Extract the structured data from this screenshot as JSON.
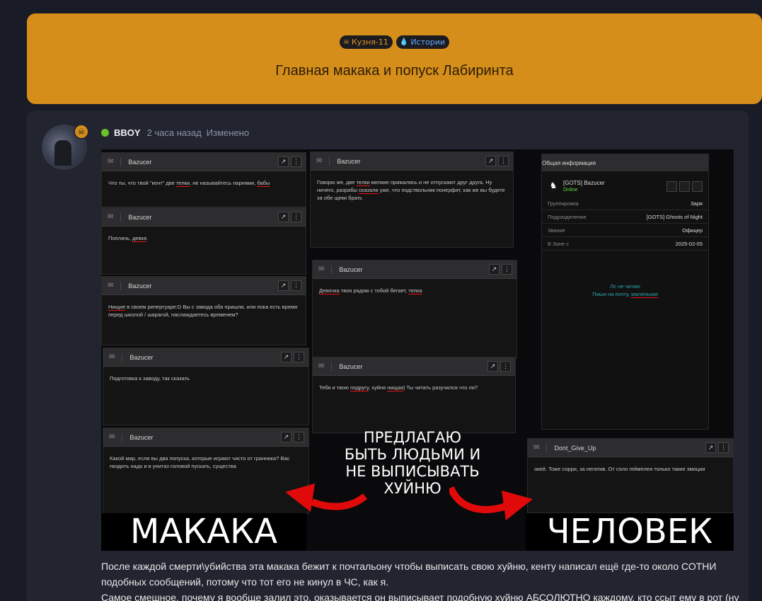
{
  "header": {
    "tags": [
      {
        "icon": "☠",
        "label": "Кузня-11"
      },
      {
        "icon": "💧",
        "label": "Истории"
      }
    ],
    "title": "Главная макака и попуск Лабиринта"
  },
  "post": {
    "username": "BBOY",
    "time": "2 часа назад",
    "edited": "Изменено",
    "paragraphs": [
      "После каждой смерти\\убийства эта макака бежит к почтальону чтобы выписать свою хуйню, кенту написал ещё где-то около СОТНИ подобных сообщений, потому что тот его не кинул в ЧС, как я.",
      "Самое смешное, почему я вообще залил это, оказывается он выписывает подобную хуйню АБСОЛЮТНО каждому, кто ссыт ему в рот (ну"
    ]
  },
  "screenshot": {
    "messages": [
      {
        "sender": "Bazucer",
        "pre": "Что ты, что твой \"кент\" две ",
        "u1": "телки",
        "mid": ", не называйтесь парнями, ",
        "u2": "бабы",
        "post": ""
      },
      {
        "sender": "Bazucer",
        "pre": "Поплачь, ",
        "u1": "девка",
        "mid": "",
        "u2": "",
        "post": ""
      },
      {
        "sender": "Bazucer",
        "pre": "",
        "u1": "Нищие",
        "mid": " в своем репертуаре:D Вы с завода оба пришли, или пока есть время перед школой / шарагой, наслаждаетесь временем?",
        "u2": "",
        "post": ""
      },
      {
        "sender": "Bazucer",
        "pre": "Подготовка к заводу, так сказать",
        "u1": "",
        "mid": "",
        "u2": "",
        "post": ""
      },
      {
        "sender": "Bazucer",
        "pre": "Какой мир, если вы два попуска, которые играют чисто от гранника? Вас пиздить надо и в унитаз головой пускать, существа",
        "u1": "",
        "mid": "",
        "u2": "",
        "post": ""
      },
      {
        "sender": "Bazucer",
        "pre": "Говорю же, две ",
        "u1": "телки",
        "mid": " мелкие прижались и не отпускают друг друга. Ну ничего, разрабы ",
        "u2": "сказали",
        "post": " уже, что подствольник понерфят, как же вы будете за обе щеки брать"
      },
      {
        "sender": "Bazucer",
        "pre": "",
        "u1": "Девочка",
        "mid": " твоя рядом с тобой бегает, ",
        "u2": "телка",
        "post": ""
      },
      {
        "sender": "Bazucer",
        "pre": "Тебя и твою ",
        "u1": "подругу",
        "mid": ", хуйня ",
        "u2": "нищая",
        "post": ") Ты читать разучился что ли?"
      },
      {
        "sender": "Dont_Give_Up",
        "pre": "окей. Тоже сорри, за негатив. От соло геймплея только такие эмоции",
        "u1": "",
        "mid": "",
        "u2": "",
        "post": ""
      }
    ],
    "info": {
      "title": "Общая информация",
      "name": "[GOTS] Bazucer",
      "status": "Online",
      "rows": [
        {
          "k": "Группировка",
          "v": "Заря"
        },
        {
          "k": "Подразделение",
          "v": "[GOTS] Ghosts of Night"
        },
        {
          "k": "Звание",
          "v": "Офицер"
        },
        {
          "k": "В Зоне с",
          "v": "2025-02-05"
        }
      ],
      "note1": "Лс не читаю",
      "note2": "Пиши на почту, ",
      "note2u": "маленькая"
    },
    "overlay": "ПРЕДЛАГАЮ БЫТЬ ЛЮДЬМИ И НЕ ВЫПИСЫВАТЬ ХУЙНЮ",
    "left_label": "МАКАКА",
    "right_label": "ЧЕЛОВЕК"
  }
}
